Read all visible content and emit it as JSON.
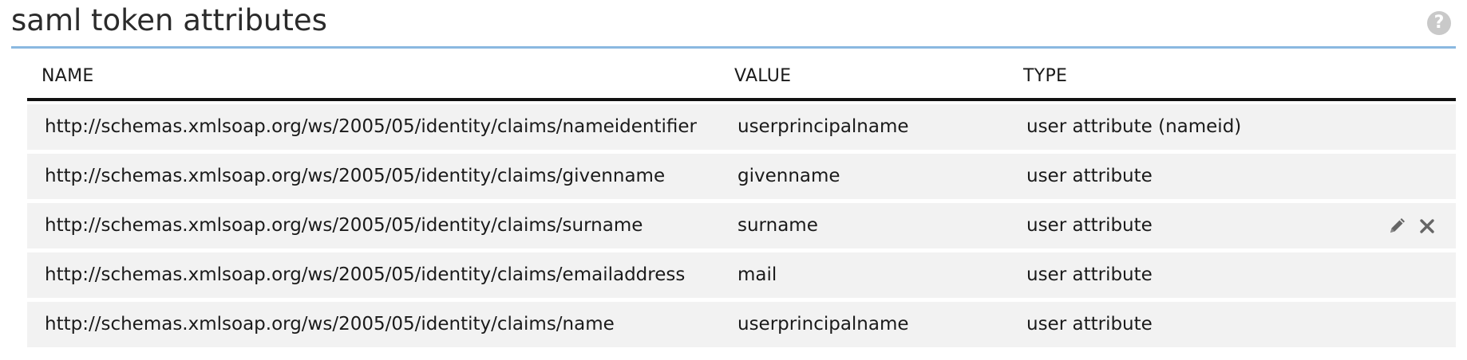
{
  "section": {
    "title": "saml token attributes",
    "help_icon": "help-icon"
  },
  "table": {
    "columns": {
      "name": "NAME",
      "value": "VALUE",
      "type": "TYPE"
    },
    "rows": [
      {
        "name": "http://schemas.xmlsoap.org/ws/2005/05/identity/claims/nameidentifier",
        "value": "userprincipalname",
        "type": "user attribute (nameid)",
        "show_actions": false
      },
      {
        "name": "http://schemas.xmlsoap.org/ws/2005/05/identity/claims/givenname",
        "value": "givenname",
        "type": "user attribute",
        "show_actions": false
      },
      {
        "name": "http://schemas.xmlsoap.org/ws/2005/05/identity/claims/surname",
        "value": "surname",
        "type": "user attribute",
        "show_actions": true
      },
      {
        "name": "http://schemas.xmlsoap.org/ws/2005/05/identity/claims/emailaddress",
        "value": "mail",
        "type": "user attribute",
        "show_actions": false
      },
      {
        "name": "http://schemas.xmlsoap.org/ws/2005/05/identity/claims/name",
        "value": "userprincipalname",
        "type": "user attribute",
        "show_actions": false
      }
    ],
    "row_actions": {
      "edit_icon": "pencil-icon",
      "delete_icon": "close-icon"
    }
  },
  "colors": {
    "accent_underline": "#8ab8e0",
    "row_background": "#f2f2f2",
    "header_rule": "#111111",
    "help_icon_bg": "#c9c9c9",
    "action_icon": "#666666"
  }
}
